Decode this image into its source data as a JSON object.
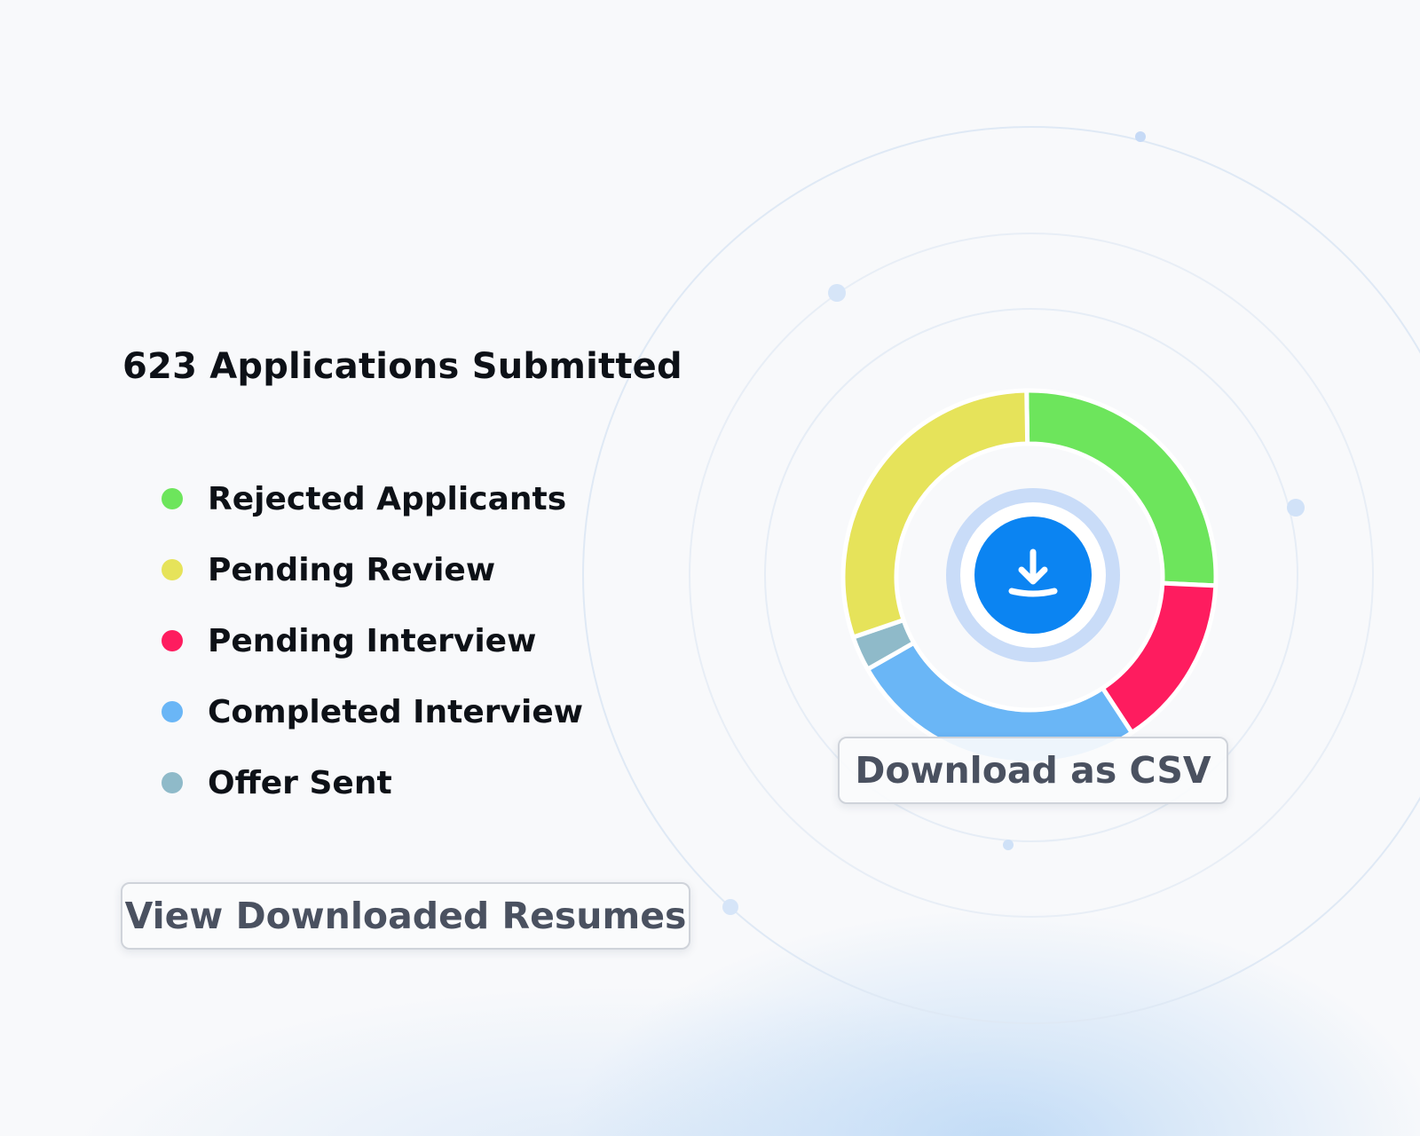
{
  "summary": {
    "title": "623 Applications Submitted"
  },
  "legend": [
    {
      "label": "Rejected Applicants",
      "color": "#6de55c"
    },
    {
      "label": "Pending Review",
      "color": "#e6e35a"
    },
    {
      "label": "Pending Interview",
      "color": "#fe1c5f"
    },
    {
      "label": "Completed Interview",
      "color": "#6ab6f6"
    },
    {
      "label": "Offer Sent",
      "color": "#8fbac9"
    }
  ],
  "actions": {
    "view_resumes_label": "View Downloaded Resumes",
    "download_csv_label": "Download as CSV",
    "download_icon": "download-icon"
  },
  "theme": {
    "accent": "#0b84f2",
    "ring_halo": "#c9dcf8"
  },
  "chart_data": {
    "type": "pie",
    "categories": [
      "Rejected Applicants",
      "Pending Interview",
      "Completed Interview",
      "Offer Sent",
      "Pending Review"
    ],
    "values": [
      26,
      15,
      26,
      3,
      30
    ],
    "colors": [
      "#6de55c",
      "#fe1c5f",
      "#6ab6f6",
      "#8fbac9",
      "#e6e35a"
    ]
  }
}
